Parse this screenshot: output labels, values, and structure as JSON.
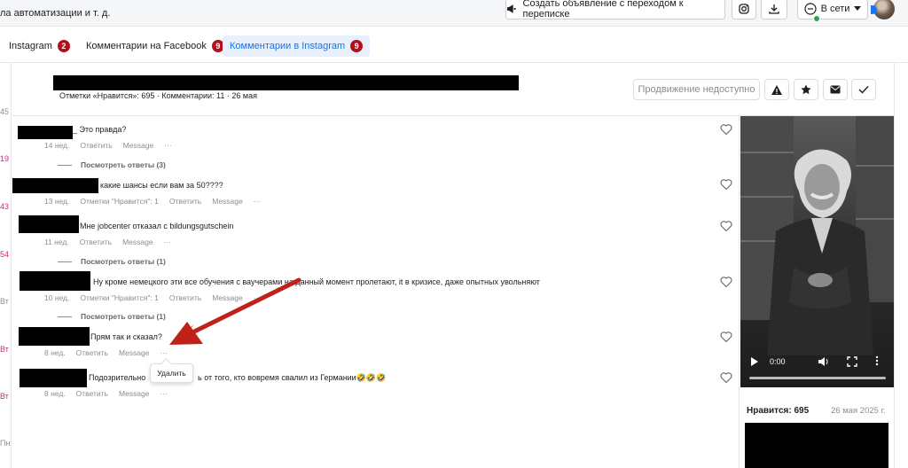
{
  "topbar": {
    "breadcrumb": "ла автоматизации и т. д.",
    "create_ad_label": "Создать объявление с переходом к переписке",
    "status_label": "В сети"
  },
  "tabs": [
    {
      "label": "Instagram",
      "count": "2"
    },
    {
      "label": "Комментарии на Facebook",
      "count": "9"
    },
    {
      "label": "Комментарии в Instagram",
      "count": "9"
    }
  ],
  "left_strip": [
    "45",
    "19",
    "43",
    "54",
    "Вт",
    "Вт",
    "Вт",
    "Пн"
  ],
  "post": {
    "meta": "Отметки «Нравится»: 695 · Комментарии: 11 · 26 мая",
    "promo_label": "Продвижение недоступно"
  },
  "comments": [
    {
      "text": "_ Это правда?",
      "time": "14 нед.",
      "likes": "",
      "reply": "Ответить",
      "message": "Message",
      "more": "···",
      "replies": "Посмотреть ответы (3)"
    },
    {
      "text": "какие шансы если вам за 50????",
      "time": "13 нед.",
      "likes": "Отметки \"Нравится\": 1",
      "reply": "Ответить",
      "message": "Message",
      "more": "···",
      "replies": ""
    },
    {
      "text": "Мне jobcenter отказал с bildungsgutschein",
      "time": "11 нед.",
      "likes": "",
      "reply": "Ответить",
      "message": "Message",
      "more": "···",
      "replies": "Посмотреть ответы (1)"
    },
    {
      "text": "Ну кроме немецкого эти все обучения с ваучерами на данный момент пролетают, it в кризисе, даже опытных увольняют",
      "time": "10 нед.",
      "likes": "Отметки \"Нравится\": 1",
      "reply": "Ответить",
      "message": "Message",
      "more": "···",
      "replies": "Посмотреть ответы (1)"
    },
    {
      "text": "Прям так и сказал?",
      "time": "8 нед.",
      "likes": "",
      "reply": "Ответить",
      "message": "Message",
      "more": "···",
      "replies": ""
    },
    {
      "text_a": "Подозрительно",
      "text_b": "ь от того, кто вовремя свалил из Германии🤣🤣🤣",
      "time": "8 нед.",
      "likes": "",
      "reply": "Ответить",
      "message": "Message",
      "more": "···",
      "replies": ""
    }
  ],
  "tooltip": {
    "label": "Удалить"
  },
  "video": {
    "time": "0:00"
  },
  "post_panel": {
    "likes": "Нравится: 695",
    "date": "26 мая 2025 г."
  },
  "colors": {
    "accent": "#1b74e4",
    "badge": "#b3101f",
    "arrow": "#c0221a"
  }
}
